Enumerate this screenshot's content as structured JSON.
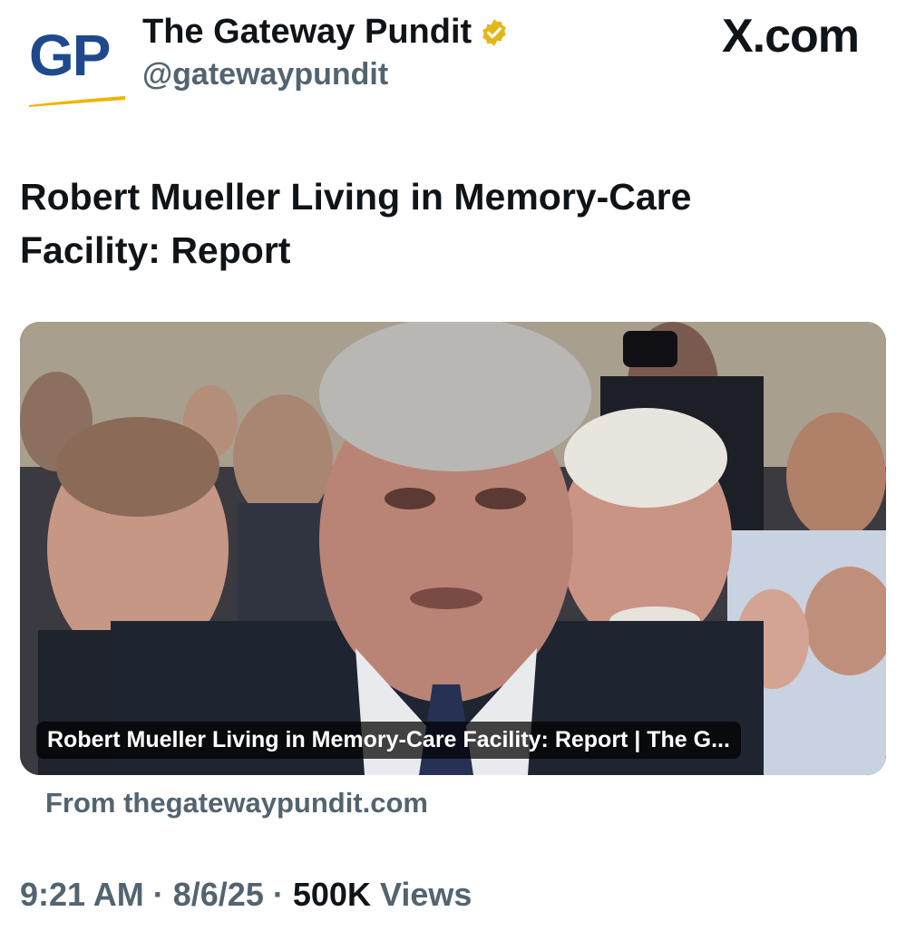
{
  "header": {
    "avatar_text": "GP",
    "display_name": "The Gateway Pundit",
    "handle": "@gatewaypundit",
    "verified": true,
    "brand": "X.com"
  },
  "post": {
    "text": "Robert Mueller Living in Memory-Care Facility: Report"
  },
  "card": {
    "caption": "Robert Mueller Living in Memory-Care Facility: Report | The G...",
    "source": "From thegatewaypundit.com"
  },
  "meta": {
    "time": "9:21 AM",
    "date": "8/6/25",
    "views_count": "500K",
    "views_label": "Views",
    "separator": "·"
  },
  "colors": {
    "primary_text": "#0f1419",
    "secondary_text": "#536471",
    "verified_gold": "#e2b719",
    "logo_blue": "#1e4a8d",
    "logo_swoosh": "#f0b400"
  }
}
